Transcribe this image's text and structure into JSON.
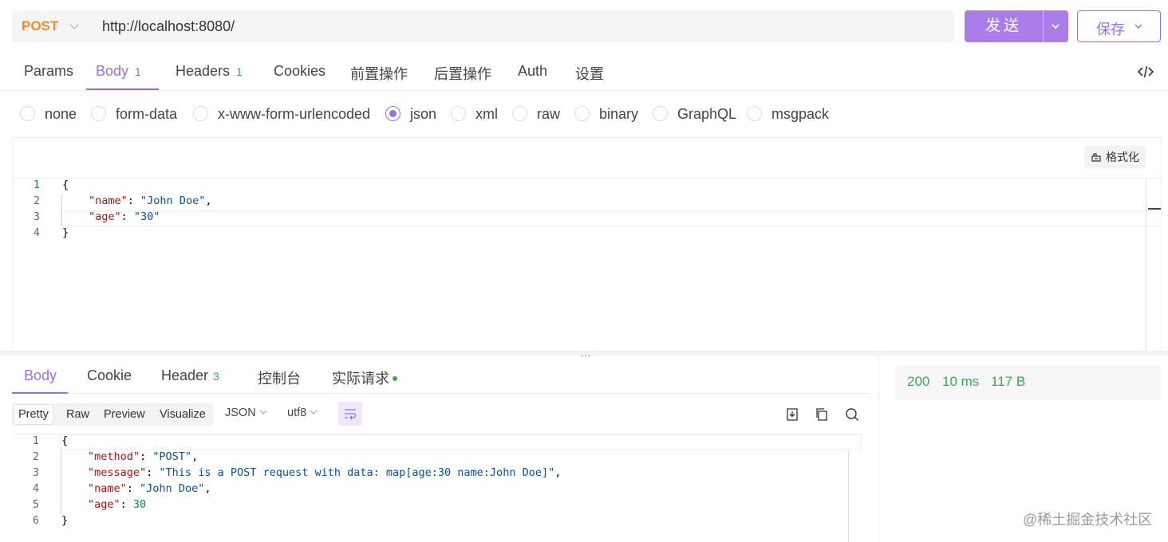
{
  "request": {
    "method": "POST",
    "url": "http://localhost:8080/",
    "send_label": "发送",
    "save_label": "保存"
  },
  "request_tabs": [
    {
      "label": "Params",
      "count": ""
    },
    {
      "label": "Body",
      "count": "1"
    },
    {
      "label": "Headers",
      "count": "1"
    },
    {
      "label": "Cookies",
      "count": ""
    },
    {
      "label": "前置操作",
      "count": ""
    },
    {
      "label": "后置操作",
      "count": ""
    },
    {
      "label": "Auth",
      "count": ""
    },
    {
      "label": "设置",
      "count": ""
    }
  ],
  "body_types": {
    "options": [
      "none",
      "form-data",
      "x-www-form-urlencoded",
      "json",
      "xml",
      "raw",
      "binary",
      "GraphQL",
      "msgpack"
    ],
    "selected": "json"
  },
  "request_editor": {
    "format_label": "格式化",
    "line_numbers": [
      "1",
      "2",
      "3",
      "4"
    ],
    "lines": {
      "l1_brace": "{",
      "l2_key": "\"name\"",
      "l2_sep": ": ",
      "l2_val": "\"John Doe\"",
      "l2_end": ",",
      "l3_key": "\"age\"",
      "l3_sep": ": ",
      "l3_val": "\"30\"",
      "l4_brace": "}"
    }
  },
  "splitter_label": "...",
  "response_tabs": [
    {
      "label": "Body",
      "count": ""
    },
    {
      "label": "Cookie",
      "count": ""
    },
    {
      "label": "Header",
      "count": "3"
    },
    {
      "label": "控制台",
      "count": ""
    },
    {
      "label": "实际请求",
      "count": ""
    }
  ],
  "view_modes": [
    "Pretty",
    "Raw",
    "Preview",
    "Visualize"
  ],
  "selected_view_mode": "Pretty",
  "format_select": "JSON",
  "encoding_select": "utf8",
  "response_editor": {
    "line_numbers": [
      "1",
      "2",
      "3",
      "4",
      "5",
      "6"
    ],
    "lines": {
      "l1_brace": "{",
      "l2_key": "\"method\"",
      "l2_sep": ": ",
      "l2_val": "\"POST\"",
      "l2_end": ",",
      "l3_key": "\"message\"",
      "l3_sep": ": ",
      "l3_val": "\"This is a POST request with data: map[age:30 name:John Doe]\"",
      "l3_end": ",",
      "l4_key": "\"name\"",
      "l4_sep": ": ",
      "l4_val": "\"John Doe\"",
      "l4_end": ",",
      "l5_key": "\"age\"",
      "l5_sep": ": ",
      "l5_val": "30",
      "l6_brace": "}"
    }
  },
  "response_meta": {
    "status": "200",
    "time": "10 ms",
    "size": "117 B"
  },
  "watermark": "@稀土掘金技术社区",
  "colors": {
    "accent": "#9b6fe0",
    "method_post": "#f08c29",
    "success": "#3ea74d"
  },
  "icons": {
    "code": "code-icon",
    "format": "format-icon",
    "download": "download-icon",
    "copy": "copy-icon",
    "search": "search-icon",
    "wrap": "wrap-lines-icon"
  }
}
